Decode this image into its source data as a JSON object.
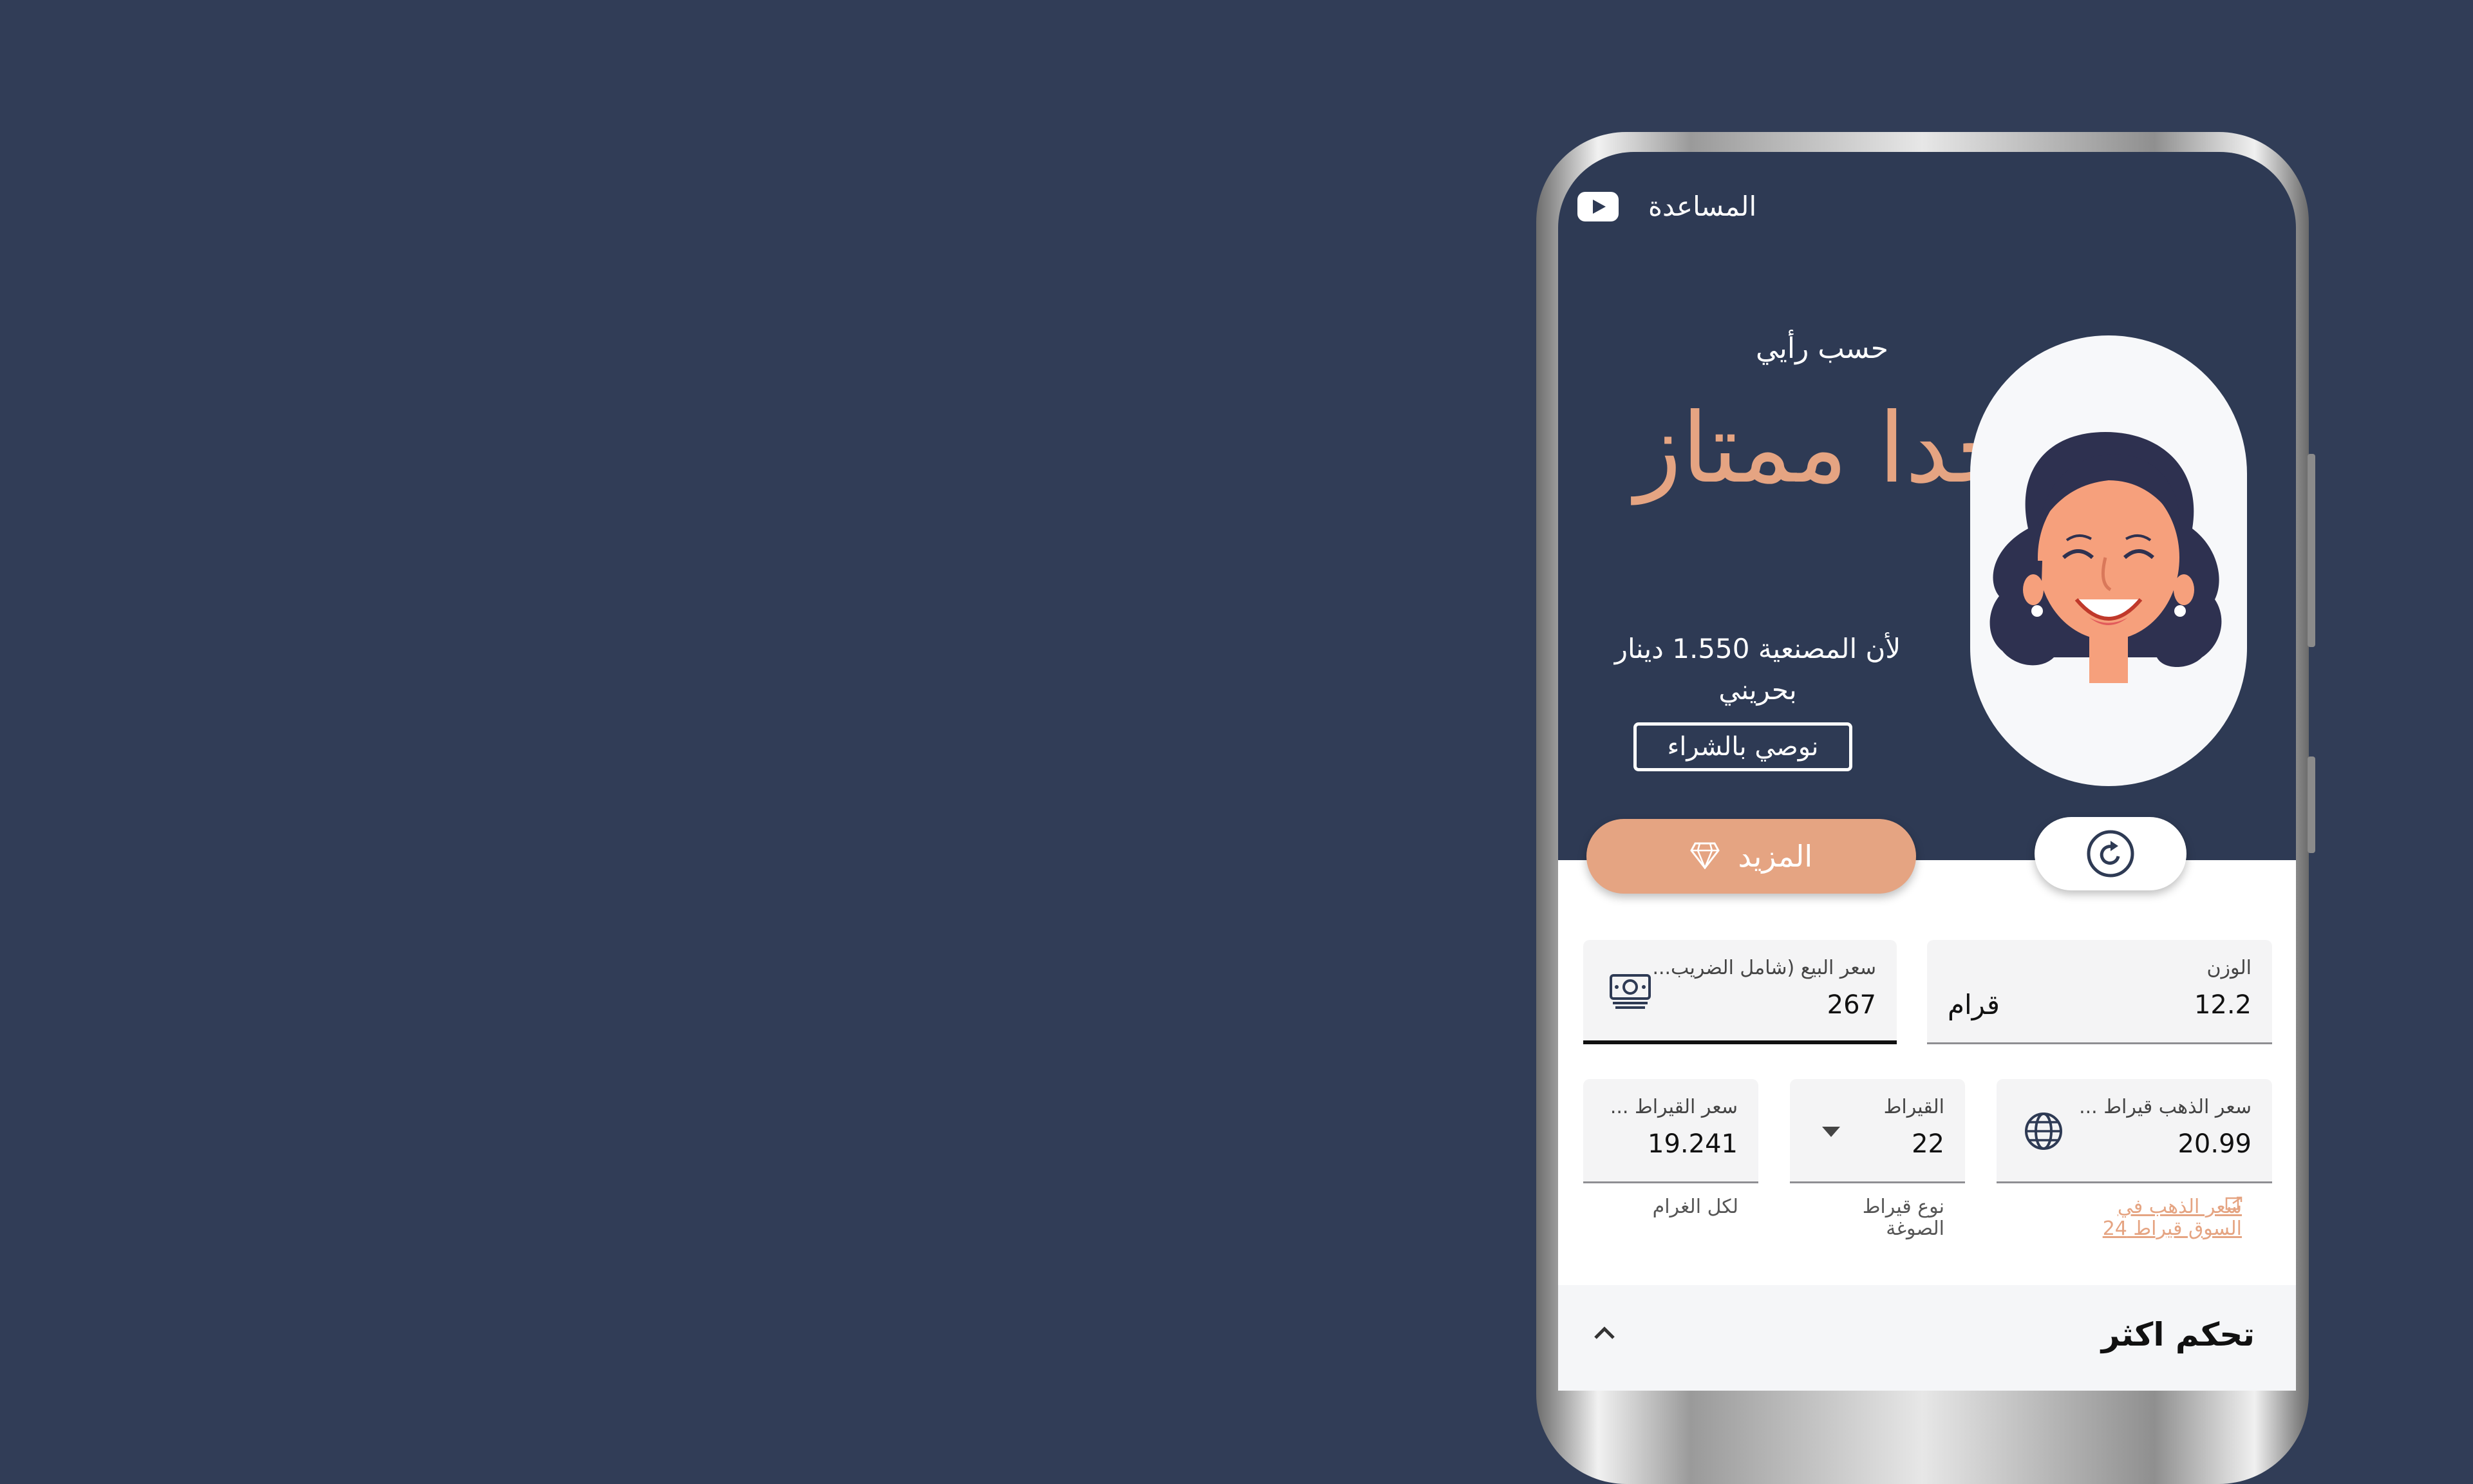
{
  "header": {
    "help_label": "المساعدة"
  },
  "recommendation": {
    "opinion_label": "حسب رأيي",
    "verdict": "جدا ممتاز",
    "reason": "لأن المصنعية 1.550 دينار بحريني",
    "action_label": "نوصي بالشراء"
  },
  "actions": {
    "more_label": "المزيد"
  },
  "form": {
    "weight": {
      "label": "الوزن",
      "value": "12.2",
      "unit": "قرام"
    },
    "sale_price": {
      "label": "سعر البيع (شامل الضريب...",
      "value": "267"
    },
    "gold_price": {
      "label": "سعر الذهب قيراط ...",
      "value": "20.99",
      "helper": "سعر الذهب في السوق قيراط 24"
    },
    "karat": {
      "label": "القيراط",
      "value": "22",
      "helper": "نوع قيراط الصوغة"
    },
    "karat_price": {
      "label": "سعر القيراط ...",
      "value": "19.241",
      "helper": "لكل الغرام"
    }
  },
  "more_control": {
    "title": "تحكم اكثر"
  },
  "colors": {
    "background": "#313d57",
    "header_bg": "#2e3a54",
    "accent": "#e5a482"
  }
}
